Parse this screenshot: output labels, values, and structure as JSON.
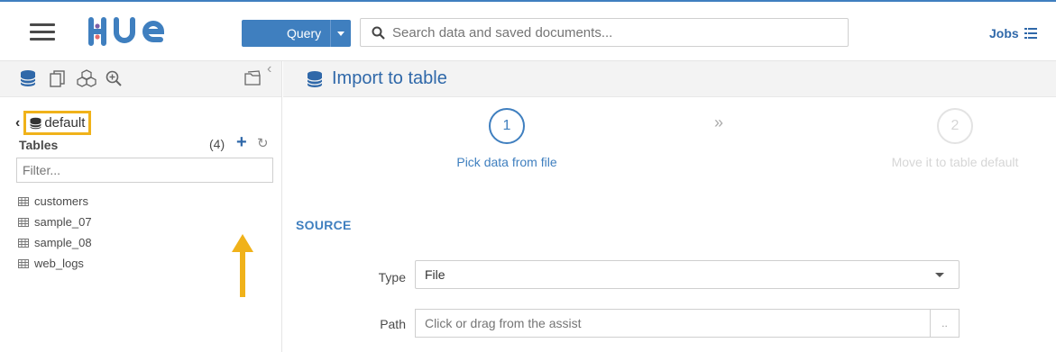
{
  "header": {
    "logo_text": "HUE",
    "query_label": "Query",
    "search_placeholder": "Search data and saved documents...",
    "jobs_label": "Jobs"
  },
  "sidebar": {
    "database": "default",
    "back_glyph": "‹",
    "tables_title": "Tables",
    "tables_count": "(4)",
    "filter_placeholder": "Filter...",
    "tables": [
      "customers",
      "sample_07",
      "sample_08",
      "web_logs"
    ],
    "icons": [
      "database-icon",
      "documents-icon",
      "jobs-icon",
      "search-plus-icon",
      "folder-open-icon"
    ]
  },
  "main": {
    "title": "Import to table",
    "steps": [
      {
        "number": "1",
        "label": "Pick data from file",
        "active": true
      },
      {
        "number": "2",
        "label": "Move it to table default",
        "active": false
      }
    ],
    "steps_separator": "»",
    "source_title": "SOURCE",
    "type_label": "Type",
    "type_value": "File",
    "path_label": "Path",
    "path_placeholder": "Click or drag from the assist",
    "path_button": ".."
  },
  "colors": {
    "accent": "#3f7fbf",
    "link": "#2f68a9",
    "highlight": "#f0b21a"
  }
}
